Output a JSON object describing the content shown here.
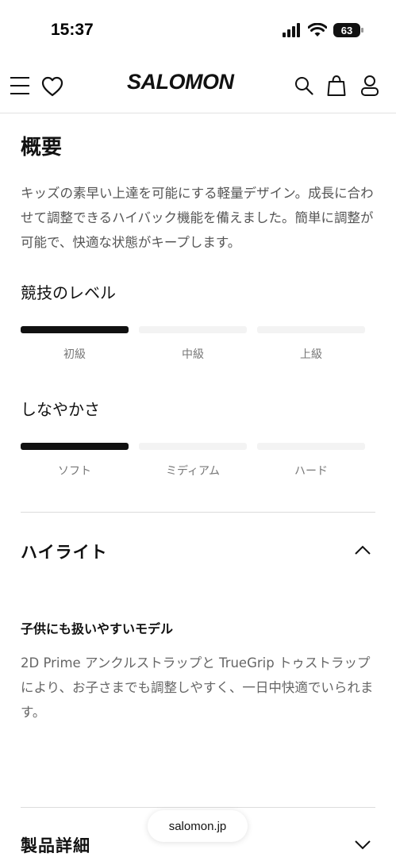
{
  "status_bar": {
    "time": "15:37",
    "battery": "63",
    "icons": [
      "signal-icon",
      "wifi-icon",
      "battery-icon"
    ]
  },
  "header": {
    "brand": "SALOMON",
    "icons": [
      "menu-icon",
      "heart-icon",
      "search-icon",
      "bag-icon",
      "user-icon"
    ]
  },
  "overview": {
    "title": "概要",
    "description": "キッズの素早い上達を可能にする軽量デザイン。成長に合わせて調整できるハイバック機能を備えました。簡単に調整が可能で、快適な状態がキープします。"
  },
  "skill_level": {
    "label": "競技のレベル",
    "ticks": [
      "初級",
      "中級",
      "上級"
    ],
    "active_index": 0
  },
  "flex": {
    "label": "しなやかさ",
    "ticks": [
      "ソフト",
      "ミディアム",
      "ハード"
    ],
    "active_index": 0
  },
  "highlights": {
    "title": "ハイライト",
    "expanded": true,
    "heading": "子供にも扱いやすいモデル",
    "body": "2D Prime アンクルストラップと TrueGrip トゥストラップにより、お子さまでも調整しやすく、一日中快適でいられます。"
  },
  "details": {
    "title": "製品詳細",
    "expanded": false
  },
  "browser": {
    "url": "salomon.jp"
  },
  "colors": {
    "text": "#111111",
    "muted": "#666666",
    "meter_active": "#111111",
    "meter_inactive": "#f3f3f3",
    "divider": "#dcdcdc"
  }
}
